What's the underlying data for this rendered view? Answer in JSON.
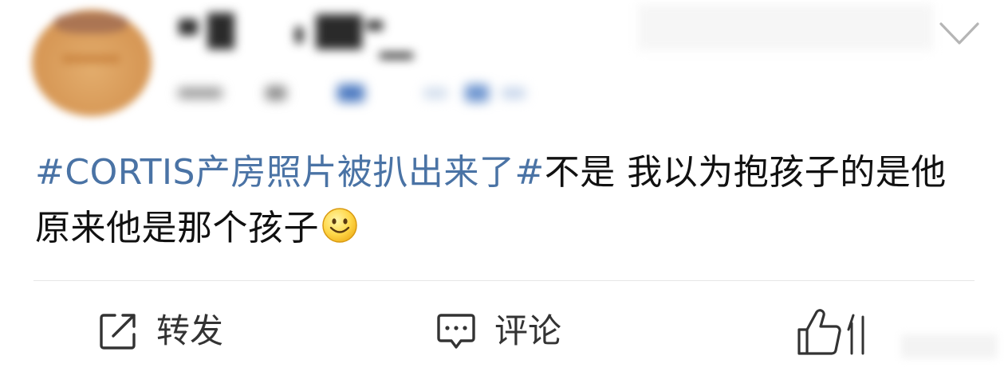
{
  "post": {
    "segments": [
      {
        "type": "hashtag",
        "text": "#CORTIS产房照片被扒出来了#"
      },
      {
        "type": "text",
        "text": "不是 我以为抱孩子的是他 原来他是那个孩子"
      }
    ],
    "emoji": "smile-emoji"
  },
  "actions": {
    "repost_label": "转发",
    "comment_label": "评论"
  },
  "colors": {
    "hashtag": "#4a73a5",
    "text": "#111111",
    "action_text": "#333333",
    "divider": "#e6e6e6"
  },
  "icons": [
    "chevron-down-icon",
    "share-icon",
    "comment-icon",
    "thumbs-up-icon",
    "smile-emoji"
  ]
}
